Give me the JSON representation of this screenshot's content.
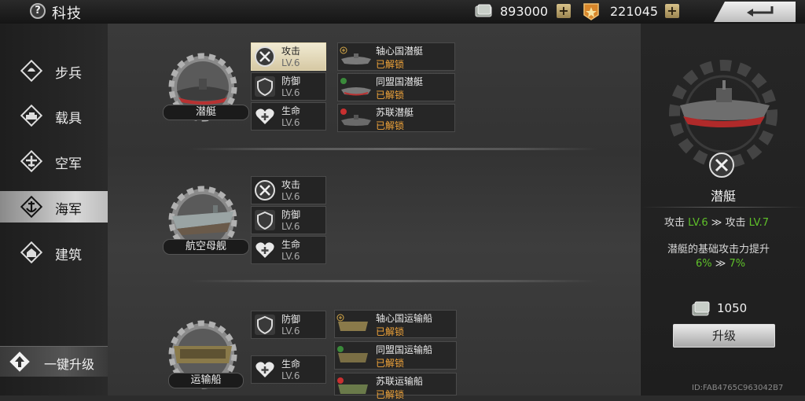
{
  "header": {
    "help_label": "?",
    "title": "科技",
    "resources": [
      {
        "icon": "cash-icon",
        "value": "893000",
        "add_label": "+"
      },
      {
        "icon": "medal-icon",
        "value": "221045",
        "add_label": "+"
      }
    ]
  },
  "sidebar": {
    "items": [
      {
        "label": "步兵",
        "icon": "infantry-icon",
        "active": false
      },
      {
        "label": "载具",
        "icon": "vehicle-icon",
        "active": false
      },
      {
        "label": "空军",
        "icon": "airforce-icon",
        "active": false
      },
      {
        "label": "海军",
        "icon": "navy-anchor-icon",
        "active": true
      },
      {
        "label": "建筑",
        "icon": "building-icon",
        "active": false
      }
    ],
    "one_key_upgrade": "一键升级"
  },
  "units": [
    {
      "name": "潜艇",
      "attributes": [
        {
          "name": "攻击",
          "level": "LV.6",
          "active": true
        },
        {
          "name": "防御",
          "level": "LV.6",
          "active": false
        },
        {
          "name": "生命",
          "level": "LV.6",
          "active": false
        }
      ],
      "unlocks": [
        {
          "name": "轴心国潜艇",
          "status": "已解锁",
          "faction": "axis"
        },
        {
          "name": "同盟国潜艇",
          "status": "已解锁",
          "faction": "allies"
        },
        {
          "name": "苏联潜艇",
          "status": "已解锁",
          "faction": "soviet"
        }
      ]
    },
    {
      "name": "航空母舰",
      "attributes": [
        {
          "name": "攻击",
          "level": "LV.6",
          "active": false
        },
        {
          "name": "防御",
          "level": "LV.6",
          "active": false
        },
        {
          "name": "生命",
          "level": "LV.6",
          "active": false
        }
      ],
      "unlocks": []
    },
    {
      "name": "运输船",
      "attributes": [
        {
          "name": "防御",
          "level": "LV.6",
          "active": false
        },
        {
          "name": "生命",
          "level": "LV.6",
          "active": false
        }
      ],
      "unlocks": [
        {
          "name": "轴心国运输船",
          "status": "已解锁",
          "faction": "axis"
        },
        {
          "name": "同盟国运输船",
          "status": "已解锁",
          "faction": "allies"
        },
        {
          "name": "苏联运输船",
          "status": "已解锁",
          "faction": "soviet"
        }
      ]
    }
  ],
  "detail": {
    "unit_name": "潜艇",
    "from_label": "攻击",
    "from_level": "LV.6",
    "arrow": "≫",
    "to_label": "攻击",
    "to_level": "LV.7",
    "description": "潜艇的基础攻击力提升",
    "from_pct": "6%",
    "to_pct": "7%",
    "cost": "1050",
    "upgrade_label": "升级"
  },
  "footer_id": "ID:FAB4765C963042B7",
  "colors": {
    "accent_green": "#5fc02a",
    "unlock_orange": "#f2a53a",
    "gold": "#d8c28a"
  }
}
